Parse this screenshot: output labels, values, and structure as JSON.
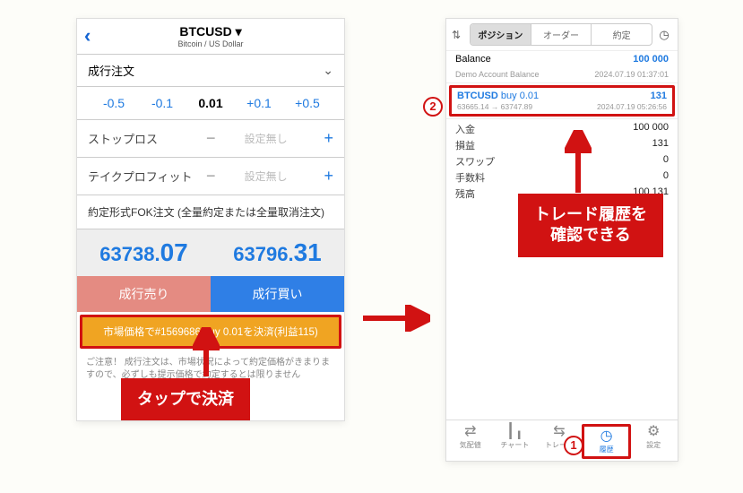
{
  "left": {
    "symbol": "BTCUSD",
    "symbol_sub": "Bitcoin / US Dollar",
    "order_type": "成行注文",
    "vol": {
      "dec2": "-0.5",
      "dec1": "-0.1",
      "value": "0.01",
      "inc1": "+0.1",
      "inc2": "+0.5"
    },
    "sl_label": "ストップロス",
    "tp_label": "テイクプロフィット",
    "none_text": "設定無し",
    "fok_text": "約定形式FOK注文 (全量約定または全量取消注文)",
    "bid_int": "63738.",
    "bid_big": "07",
    "ask_int": "63796.",
    "ask_big": "31",
    "sell_label": "成行売り",
    "buy_label": "成行買い",
    "close_text": "市場価格で#1569686 buy 0.01を決済(利益115)",
    "notice": "ご注意！ 成行注文は、市場状況によって約定価格がきまりますので、必ずしも提示価格で約定するとは限りません"
  },
  "right": {
    "seg": {
      "a": "ポジション",
      "b": "オーダー",
      "c": "約定"
    },
    "balance_label": "Balance",
    "balance_val": "100 000",
    "acct_label": "Demo Account Balance",
    "acct_time": "2024.07.19 01:37:01",
    "hist": {
      "sym": "BTCUSD",
      "side": "buy 0.01",
      "pl": "131",
      "prices": "63665.14 → 63747.89",
      "time": "2024.07.19 05:26:56"
    },
    "rows": [
      {
        "lbl": "入金",
        "val": "100 000"
      },
      {
        "lbl": "損益",
        "val": "131"
      },
      {
        "lbl": "スワップ",
        "val": "0"
      },
      {
        "lbl": "手数料",
        "val": "0"
      },
      {
        "lbl": "残高",
        "val": "100 131"
      }
    ],
    "tabs": {
      "quotes": "気配値",
      "chart": "チャート",
      "trade": "トレード",
      "history": "履歴",
      "settings": "設定"
    }
  },
  "callouts": {
    "tap": "タップで決済",
    "hist": "トレード履歴を\n確認できる"
  },
  "markers": {
    "one": "1",
    "two": "2"
  }
}
